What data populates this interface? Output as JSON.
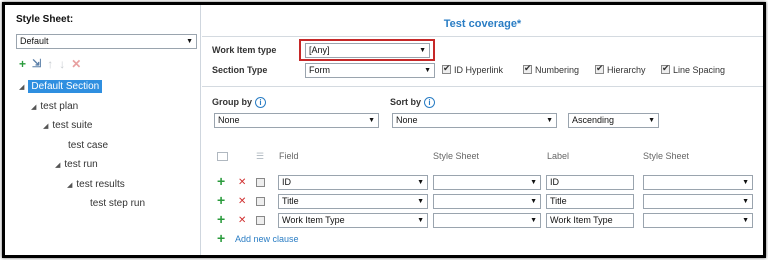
{
  "left": {
    "title": "Style Sheet:",
    "stylesheet_value": "Default",
    "tree": [
      {
        "label": "Default Section",
        "selected": true
      },
      {
        "label": "test plan"
      },
      {
        "label": "test suite"
      },
      {
        "label": "test case"
      },
      {
        "label": "test run"
      },
      {
        "label": "test results"
      },
      {
        "label": "test step run"
      }
    ]
  },
  "right": {
    "title": "Test coverage*",
    "work_item_type_label": "Work Item type",
    "work_item_type_value": "[Any]",
    "section_type_label": "Section Type",
    "section_type_value": "Form",
    "options": [
      "ID Hyperlink",
      "Numbering",
      "Hierarchy",
      "Line Spacing"
    ],
    "group_by_label": "Group by",
    "group_by_value": "None",
    "sort_by_label": "Sort by",
    "sort_by_value": "None",
    "sort_order_value": "Ascending",
    "columns": {
      "field": "Field",
      "style_sheet": "Style Sheet",
      "label": "Label",
      "style_sheet2": "Style Sheet"
    },
    "rows": [
      {
        "field": "ID",
        "label": "ID"
      },
      {
        "field": "Title",
        "label": "Title"
      },
      {
        "field": "Work Item Type",
        "label": "Work Item Type"
      }
    ],
    "add_new_clause": "Add new clause"
  },
  "colors": {
    "accent": "#2a7dc4",
    "selection": "#2f8fe0",
    "add": "#2a9b3c",
    "delete": "#d03030",
    "highlight_border": "#c62828"
  }
}
